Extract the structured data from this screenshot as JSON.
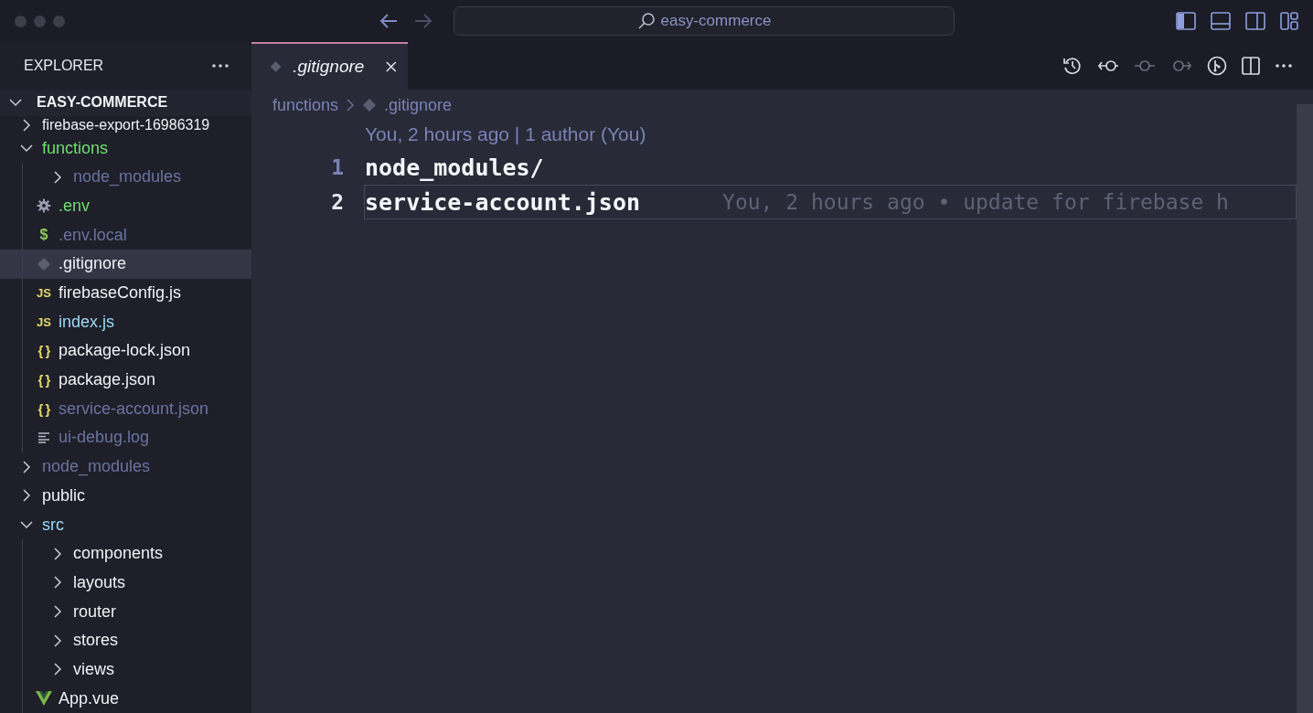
{
  "titlebar": {
    "search": "easy-commerce"
  },
  "explorer": {
    "title": "EXPLORER",
    "root": {
      "label": "EASY-COMMERCE",
      "expanded": true
    },
    "tree": [
      {
        "label": "firebase-export-16986319",
        "kind": "folder",
        "expanded": false,
        "color": "#f0f1f5",
        "selected": false
      },
      {
        "label": "functions",
        "kind": "folder",
        "expanded": true,
        "color": "#6ee06e",
        "selected": false,
        "children": [
          {
            "label": "node_modules",
            "kind": "folder",
            "expanded": false,
            "color": "#6a73a0",
            "selected": false
          },
          {
            "label": ".env",
            "kind": "settings",
            "color": "#6ee06e",
            "selected": false
          },
          {
            "label": ".env.local",
            "kind": "env",
            "icon": "$",
            "color": "#6a73a0",
            "selected": false
          },
          {
            "label": ".gitignore",
            "kind": "git",
            "color": "#f0f1f5",
            "selected": true
          },
          {
            "label": "firebaseConfig.js",
            "kind": "js",
            "icon": "JS",
            "color": "#f0f1f5",
            "selected": false
          },
          {
            "label": "index.js",
            "kind": "js",
            "icon": "JS",
            "color": "#9ad9f5",
            "selected": false
          },
          {
            "label": "package-lock.json",
            "kind": "json",
            "icon": "{ }",
            "color": "#f0f1f5",
            "selected": false
          },
          {
            "label": "package.json",
            "kind": "json",
            "icon": "{ }",
            "color": "#f0f1f5",
            "selected": false
          },
          {
            "label": "service-account.json",
            "kind": "json",
            "icon": "{ }",
            "color": "#6a73a0",
            "selected": false
          },
          {
            "label": "ui-debug.log",
            "kind": "text",
            "color": "#6a73a0",
            "selected": false
          }
        ]
      },
      {
        "label": "node_modules",
        "kind": "folder",
        "expanded": false,
        "color": "#6a73a0",
        "selected": false
      },
      {
        "label": "public",
        "kind": "folder",
        "expanded": false,
        "color": "#f0f1f5",
        "selected": false
      },
      {
        "label": "src",
        "kind": "folder",
        "expanded": true,
        "color": "#9ad9f5",
        "selected": false,
        "children": [
          {
            "label": "components",
            "kind": "folder",
            "expanded": false,
            "color": "#f0f1f5",
            "selected": false
          },
          {
            "label": "layouts",
            "kind": "folder",
            "expanded": false,
            "color": "#f0f1f5",
            "selected": false
          },
          {
            "label": "router",
            "kind": "folder",
            "expanded": false,
            "color": "#f0f1f5",
            "selected": false
          },
          {
            "label": "stores",
            "kind": "folder",
            "expanded": false,
            "color": "#f0f1f5",
            "selected": false
          },
          {
            "label": "views",
            "kind": "folder",
            "expanded": false,
            "color": "#f0f1f5",
            "selected": false
          },
          {
            "label": "App.vue",
            "kind": "vue",
            "color": "#f0f1f5",
            "selected": false
          }
        ]
      }
    ]
  },
  "tabs": [
    {
      "label": ".gitignore",
      "selected": true
    }
  ],
  "breadcrumb": [
    "functions",
    ".gitignore"
  ],
  "editor": {
    "codelens": "You, 2 hours ago | 1 author (You)",
    "lines": [
      {
        "number": "1",
        "text": "node_modules/",
        "active": false
      },
      {
        "number": "2",
        "text": "service-account.json",
        "active": true,
        "blame": "You, 2 hours ago • update for firebase h"
      }
    ]
  }
}
